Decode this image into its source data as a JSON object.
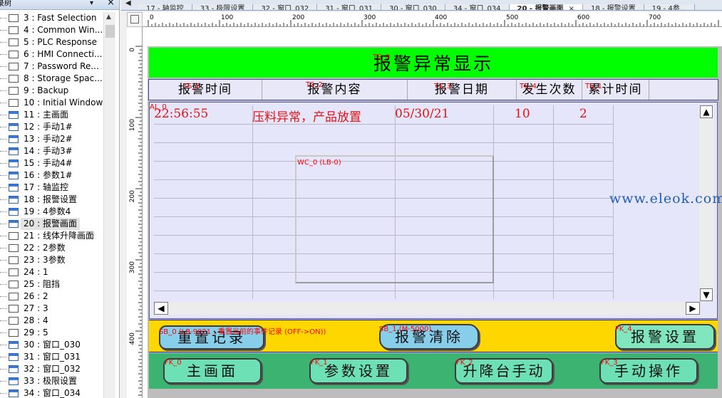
{
  "tree": {
    "title": "录树",
    "items": [
      {
        "label": "3 : Fast Selection",
        "blue": false
      },
      {
        "label": "4 : Common Win...",
        "blue": false
      },
      {
        "label": "5 : PLC Response",
        "blue": false
      },
      {
        "label": "6 : HMI Connecti...",
        "blue": false
      },
      {
        "label": "7 : Password Re...",
        "blue": false
      },
      {
        "label": "8 : Storage Spac...",
        "blue": false
      },
      {
        "label": "9 : Backup",
        "blue": false
      },
      {
        "label": "10 : Initial Window",
        "blue": false
      },
      {
        "label": "11 : 主画面",
        "blue": true
      },
      {
        "label": "12 : 手动1#",
        "blue": true
      },
      {
        "label": "13 : 手动2#",
        "blue": true
      },
      {
        "label": "14 : 手动3#",
        "blue": true
      },
      {
        "label": "15 : 手动4#",
        "blue": true
      },
      {
        "label": "16 : 参数1#",
        "blue": true
      },
      {
        "label": "17 : 轴监控",
        "blue": true
      },
      {
        "label": "18 : 报警设置",
        "blue": true
      },
      {
        "label": "19 : 4参数4",
        "blue": true
      },
      {
        "label": "20 : 报警画面",
        "blue": true,
        "selected": true
      },
      {
        "label": "21 : 线体升降画面",
        "blue": false
      },
      {
        "label": "22 : 2参数",
        "blue": false
      },
      {
        "label": "23 : 3参数",
        "blue": false
      },
      {
        "label": "24 : 1",
        "blue": false
      },
      {
        "label": "25 : 阻挡",
        "blue": false
      },
      {
        "label": "26 : 2",
        "blue": false
      },
      {
        "label": "27 : 3",
        "blue": false
      },
      {
        "label": "28 : 4",
        "blue": false
      },
      {
        "label": "29 : 5",
        "blue": false
      },
      {
        "label": "30 : 窗口_030",
        "blue": true
      },
      {
        "label": "31 : 窗口_031",
        "blue": true
      },
      {
        "label": "32 : 窗口_032",
        "blue": true
      },
      {
        "label": "33 : 极限设置",
        "blue": true
      },
      {
        "label": "34 : 窗口_034",
        "blue": true
      }
    ]
  },
  "tabs": [
    {
      "label": "17 - 轴监控",
      "active": false
    },
    {
      "label": "33 - 极限设置",
      "active": false
    },
    {
      "label": "32 - 窗口_032",
      "active": false
    },
    {
      "label": "31 - 窗口_031",
      "active": false
    },
    {
      "label": "30 - 窗口_030",
      "active": false
    },
    {
      "label": "34 - 窗口_034",
      "active": false
    },
    {
      "label": "20 - 报警画面",
      "active": true
    },
    {
      "label": "18 - 报警设置",
      "active": false
    },
    {
      "label": "19 - 4参...",
      "active": false
    }
  ],
  "ruler": {
    "marks": [
      "0",
      "100",
      "200",
      "300",
      "400",
      "500",
      "600",
      "700"
    ],
    "vmarks": [
      "0",
      "100",
      "200",
      "300",
      "400"
    ]
  },
  "screen": {
    "title": "报警异常显示",
    "title_id": "TS_0",
    "headers": [
      "报警时间",
      "报警内容",
      "报警日期",
      "发生次数",
      "累计时间"
    ],
    "header_ids": [
      "TS_5",
      "TS_2",
      "TS_3",
      "TS_4",
      "TS_1"
    ],
    "alarm_id": "AL_0",
    "alarm_row": {
      "time": "22:56:55",
      "content": "压料异常，产品放置",
      "date": "05/30/21",
      "count": "10",
      "total": "2"
    },
    "wc_label": "WC_0 (LB-0)",
    "sb0_label": "SB_0 (LB-9021 : 重置当前的事件记录 (OFF->ON))",
    "sb1_label": "SB_1 (M-5000)",
    "fk4_label": "FK_4",
    "fk0_label": "FK_0",
    "fk1_label": "FK_1",
    "fk2_label": "FK_2",
    "fk3_label": "FK_3",
    "btn_reset": "重置记录",
    "btn_clear": "报警清除",
    "btn_alarm_settings": "报警设置",
    "btn_main": "主画面",
    "btn_params": "参数设置",
    "btn_lift": "升降台手动",
    "btn_manual": "手动操作"
  },
  "watermark": "www.eleok.com",
  "colors": {
    "title_bg": "#00ff00",
    "list_bg": "#e6e6fa",
    "yellow_bar": "#ffd700",
    "green_bar": "#3cb371",
    "alarm_text": "#e01414"
  }
}
